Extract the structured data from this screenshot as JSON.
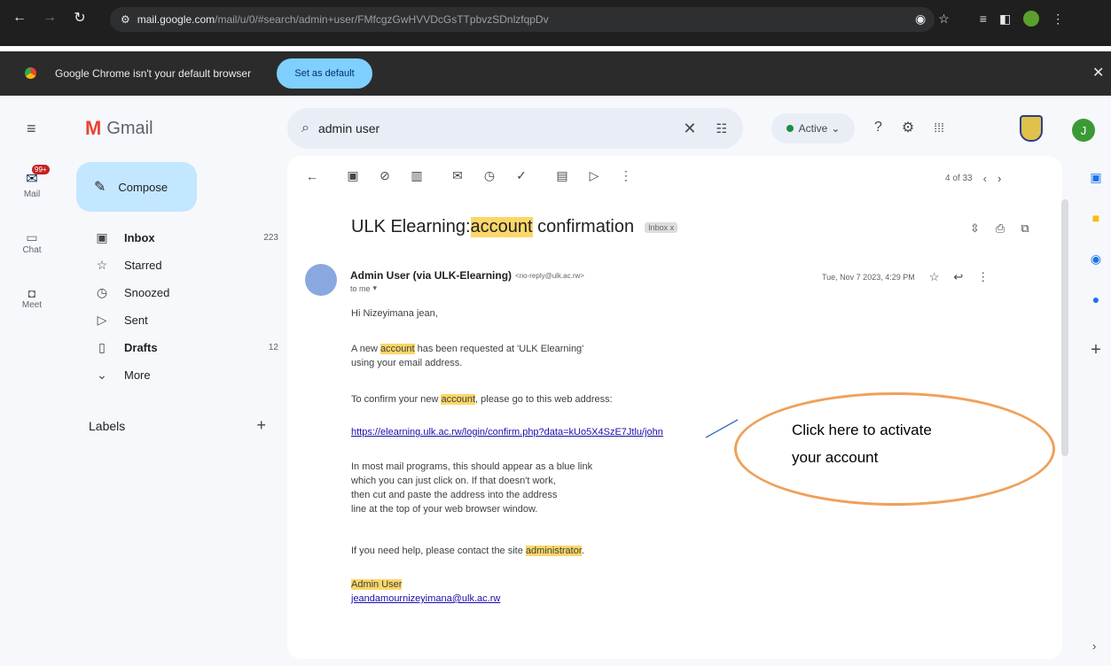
{
  "browser": {
    "url_host": "mail.google.com",
    "url_path": "/mail/u/0/#search/admin+user/FMfcgzGwHVVDcGsTTpbvzSDnlzfqpDv",
    "default_message": "Google Chrome isn't your default browser",
    "set_default_label": "Set as default"
  },
  "gmail": {
    "app_name": "Gmail",
    "compose_label": "Compose",
    "mail_badge": "99+",
    "rail": {
      "mail": "Mail",
      "chat": "Chat",
      "meet": "Meet"
    },
    "nav": [
      {
        "label": "Inbox",
        "count": "223"
      },
      {
        "label": "Starred",
        "count": ""
      },
      {
        "label": "Snoozed",
        "count": ""
      },
      {
        "label": "Sent",
        "count": ""
      },
      {
        "label": "Drafts",
        "count": "12"
      },
      {
        "label": "More",
        "count": ""
      }
    ],
    "labels_heading": "Labels",
    "search_value": "admin user",
    "status": "Active",
    "avatar_initial": "J"
  },
  "email": {
    "pagination": "4 of 33",
    "subject_pre": "ULK Elearning: ",
    "subject_hl": "account",
    "subject_post": " confirmation",
    "inbox_tag": "Inbox x",
    "sender_name": "Admin User (via ULK-Elearning)",
    "sender_email": "<no-reply@ulk.ac.rw>",
    "to_me": "to me",
    "date": "Tue, Nov 7 2023, 4:29 PM",
    "greeting": "Hi Nizeyimana jean,",
    "p1_pre": "A new ",
    "p1_hl": "account",
    "p1_post": " has been requested at 'ULK Elearning'",
    "p1_line2": "using your email address.",
    "p2_pre": "To confirm your new ",
    "p2_hl": "account",
    "p2_post": ", please go to this web address:",
    "link": "https://elearning.ulk.ac.rw/login/confirm.php?data=kUo5X4SzE7Jtlu/john",
    "p3_l1": "In most mail programs, this should appear as a blue link",
    "p3_l2": "which you can just click on. If that doesn't work,",
    "p3_l3": "then cut and paste the address into the address",
    "p3_l4": "line at the top of your web browser window.",
    "p4_pre": "If you need help, please contact the site ",
    "p4_hl": "administrator",
    "p4_post": ".",
    "sig_name": "Admin User",
    "sig_email": "jeandamournizeyimana@ulk.ac.rw"
  },
  "annotation": {
    "line1": "Click here to activate",
    "line2": "your account"
  }
}
